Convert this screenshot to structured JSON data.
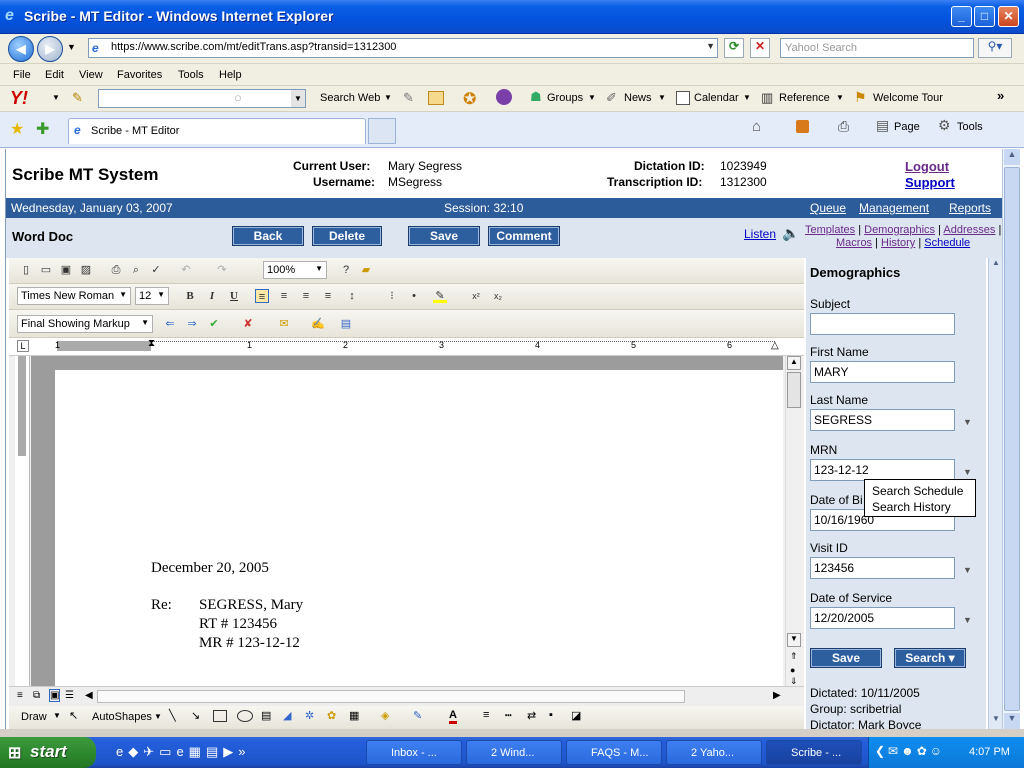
{
  "window": {
    "title": "Scribe - MT Editor - Windows Internet Explorer",
    "min": "_",
    "max": "□",
    "close": "✕"
  },
  "browser": {
    "address": "https://www.scribe.com/mt/editTrans.asp?transid=1312300",
    "search_placeholder": "Yahoo! Search",
    "menu": [
      "File",
      "Edit",
      "View",
      "Favorites",
      "Tools",
      "Help"
    ],
    "yahoo_toolbar": {
      "search_web": "Search Web",
      "groups": "Groups",
      "news": "News",
      "calendar": "Calendar",
      "reference": "Reference",
      "welcome": "Welcome Tour"
    },
    "tab": "Scribe - MT Editor",
    "cmd": {
      "page": "Page",
      "tools": "Tools"
    }
  },
  "app": {
    "title": "Scribe MT System",
    "current_user_label": "Current User:",
    "current_user": "Mary Segress",
    "username_label": "Username:",
    "username": "MSegress",
    "dictation_label": "Dictation ID:",
    "dictation_id": "1023949",
    "transcription_label": "Transcription ID:",
    "transcription_id": "1312300",
    "logout": "Logout",
    "support": "Support",
    "date": "Wednesday, January 03, 2007",
    "session": "Session: 32:10",
    "nav": [
      "Queue",
      "Management",
      "Reports"
    ],
    "section": "Word Doc",
    "buttons": {
      "back": "Back",
      "delete": "Delete",
      "save": "Save",
      "comment": "Comment"
    },
    "listen": "Listen",
    "links": {
      "templates": "Templates",
      "demographics": "Demographics",
      "addresses": "Addresses",
      "macros": "Macros",
      "history": "History",
      "schedule": "Schedule"
    }
  },
  "word": {
    "zoom": "100%",
    "font": "Times New Roman",
    "size": "12",
    "markup": "Final Showing Markup",
    "draw": "Draw",
    "autoshapes": "AutoShapes",
    "ruler": [
      "1",
      "2",
      "3",
      "4",
      "5",
      "6"
    ],
    "doc": {
      "date": "December 20, 2005",
      "re": "Re:",
      "line1": "SEGRESS, Mary",
      "line2": "RT # 123456",
      "line3": "MR # 123-12-12"
    }
  },
  "demographics": {
    "title": "Demographics",
    "subject_label": "Subject",
    "subject": "",
    "first_label": "First Name",
    "first": "MARY",
    "last_label": "Last Name",
    "last": "SEGRESS",
    "mrn_label": "MRN",
    "mrn": "123-12-12",
    "dob_label": "Date of Bi",
    "dob": "10/16/1960",
    "visit_label": "Visit ID",
    "visit": "123456",
    "dos_label": "Date of Service",
    "dos": "12/20/2005",
    "save": "Save",
    "search": "Search ▾",
    "dictated": "Dictated: 10/11/2005",
    "group": "Group: scribetrial",
    "dictator": "Dictator: Mark Boyce",
    "tooltip": [
      "Search Schedule",
      "Search History"
    ]
  },
  "taskbar": {
    "start": "start",
    "tasks": [
      "Inbox - ...",
      "2 Wind...",
      "FAQS - M...",
      "2 Yaho...",
      "Scribe - ..."
    ],
    "clock": "4:07 PM"
  },
  "colors": {
    "blue_bar": "#2c5c99",
    "panel": "#dde6f0",
    "xp_blue": "#0453de"
  }
}
